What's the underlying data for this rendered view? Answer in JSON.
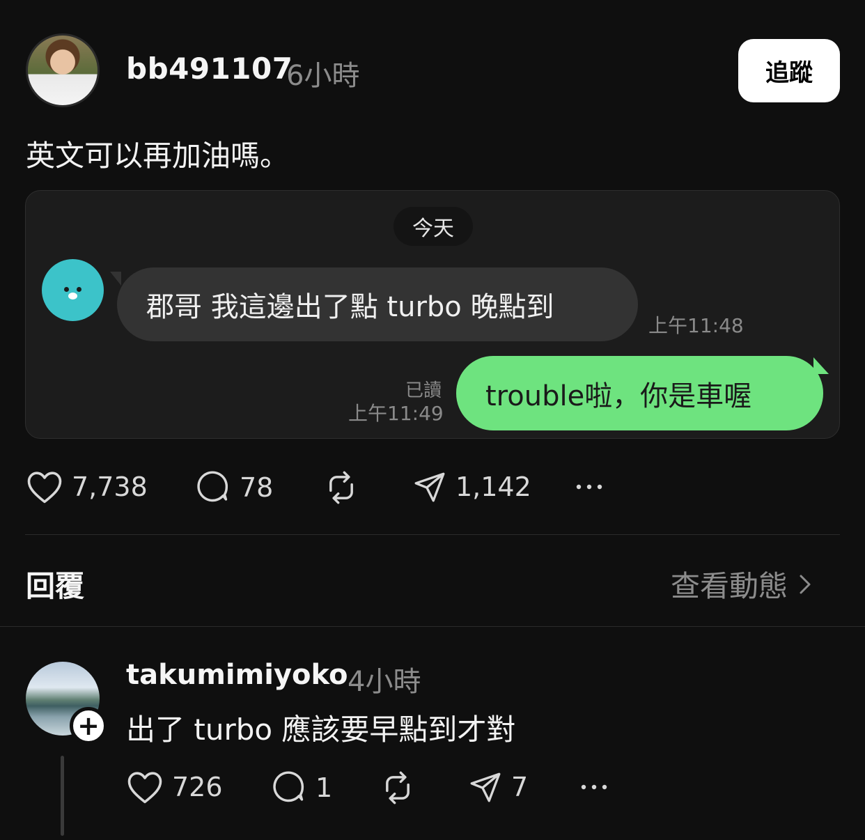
{
  "post": {
    "username": "bb491107",
    "time_ago": "6小時",
    "follow_label": "追蹤",
    "text": "英文可以再加油嗎。",
    "chat_image": {
      "date_pill": "今天",
      "incoming_message": "郡哥 我這邊出了點 turbo 晚點到",
      "incoming_time": "上午11:48",
      "outgoing_message": "trouble啦，你是車喔",
      "read_label": "已讀",
      "outgoing_time": "上午11:49"
    },
    "stats": {
      "likes": "7,738",
      "comments": "78",
      "shares": "1,142"
    }
  },
  "replies_section": {
    "title": "回覆",
    "view_activity": "查看動態"
  },
  "reply": {
    "username": "takumimiyoko",
    "time_ago": "4小時",
    "text": "出了 turbo 應該要早點到才對",
    "stats": {
      "likes": "726",
      "comments": "1",
      "shares": "7"
    }
  },
  "colors": {
    "background": "#0f0f0f",
    "outgoing_bubble": "#6ee37f",
    "incoming_bubble": "#333333",
    "bot_avatar": "#3cc3c9"
  },
  "icons": [
    "heart-icon",
    "comment-icon",
    "repost-icon",
    "share-icon",
    "more-icon",
    "chevron-right-icon",
    "plus-icon"
  ]
}
